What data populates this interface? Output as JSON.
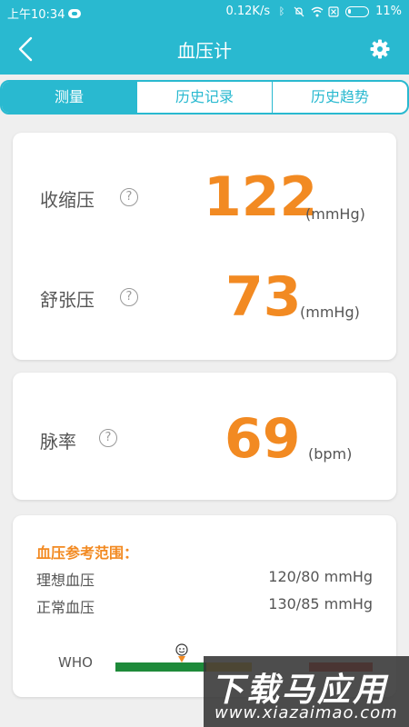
{
  "status_bar": {
    "time": "上午10:34",
    "network_speed": "0.12K/s",
    "battery": "11%",
    "icons": [
      "cloud-icon",
      "bluetooth-icon",
      "mute-icon",
      "wifi-icon",
      "sim-icon",
      "battery-icon"
    ]
  },
  "header": {
    "title": "血压计",
    "back_icon": "back-arrow-icon",
    "settings_icon": "gear-icon"
  },
  "tabs": [
    {
      "label": "测量",
      "active": true
    },
    {
      "label": "历史记录",
      "active": false
    },
    {
      "label": "历史趋势",
      "active": false
    }
  ],
  "measurement": {
    "systolic": {
      "label": "收缩压",
      "value": "122",
      "unit": "(mmHg)"
    },
    "diastolic": {
      "label": "舒张压",
      "value": "73",
      "unit": "(mmHg)"
    },
    "pulse": {
      "label": "脉率",
      "value": "69",
      "unit": "(bpm)"
    },
    "help_glyph": "?"
  },
  "reference": {
    "title": "血压参考范围：",
    "rows": [
      {
        "label": "理想血压",
        "value": "120/80 mmHg"
      },
      {
        "label": "正常血压",
        "value": "130/85 mmHg"
      }
    ],
    "scale_label": "WHO",
    "marker_icon": "smiley-marker-icon"
  },
  "watermark": {
    "line1": "下载马应用",
    "line2": "www.xiazaimao.com"
  },
  "colors": {
    "primary": "#29b9d0",
    "accent": "#f28a22",
    "green": "#1e8a3a",
    "yellow": "#f2c232",
    "red": "#e23b2e"
  }
}
